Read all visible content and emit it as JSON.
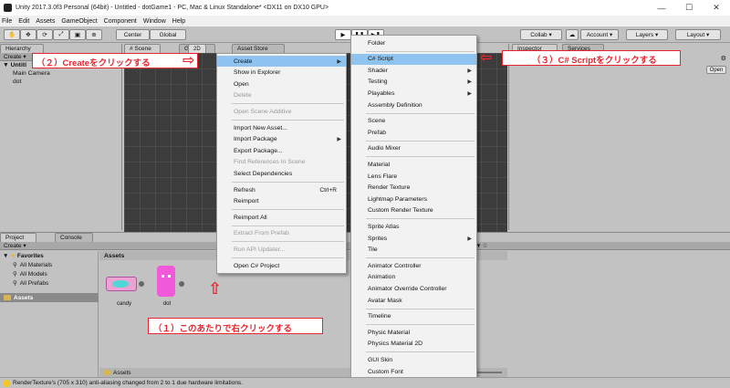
{
  "window": {
    "title": "Unity 2017.3.0f3 Personal (64bit) - Untitled - dotGame1 - PC, Mac & Linux Standalone* <DX11 on DX10 GPU>",
    "min": "—",
    "max": "☐",
    "close": "✕"
  },
  "menubar": [
    "File",
    "Edit",
    "Assets",
    "GameObject",
    "Component",
    "Window",
    "Help"
  ],
  "toolbar": {
    "center": "Center",
    "global": "Global",
    "collab": "Collab",
    "account": "Account",
    "layers": "Layers",
    "layout": "Layout",
    "play": "▶",
    "pause": "❚❚",
    "step": "▶❚"
  },
  "hierarchy": {
    "tab": "Hierarchy",
    "create": "Create",
    "scene": "Untitl",
    "items": [
      "Main Camera",
      "dot"
    ]
  },
  "scene_tabs": {
    "scene": "Scene",
    "game": "Game",
    "asset_store": "Asset Store",
    "mode": "2D"
  },
  "inspector": {
    "tab": "Inspector",
    "services": "Services",
    "open": "Open"
  },
  "project": {
    "tab": "Project",
    "console": "Console",
    "create": "Create",
    "favorites": "Favorites",
    "fav_items": [
      "All Materials",
      "All Models",
      "All Prefabs"
    ],
    "assets_root": "Assets",
    "assets_header": "Assets",
    "assets": [
      "candy",
      "dot"
    ],
    "footer": "Assets"
  },
  "context_menu": {
    "items": [
      {
        "label": "Create",
        "arrow": "▶",
        "state": "highlight"
      },
      {
        "label": "Show in Explorer"
      },
      {
        "label": "Open"
      },
      {
        "label": "Delete",
        "state": "disabled"
      },
      {
        "sep": true
      },
      {
        "label": "Open Scene Additive",
        "state": "disabled"
      },
      {
        "sep": true
      },
      {
        "label": "Import New Asset..."
      },
      {
        "label": "Import Package",
        "arrow": "▶"
      },
      {
        "label": "Export Package..."
      },
      {
        "label": "Find References In Scene",
        "state": "disabled"
      },
      {
        "label": "Select Dependencies"
      },
      {
        "sep": true
      },
      {
        "label": "Refresh",
        "shortcut": "Ctrl+R"
      },
      {
        "label": "Reimport"
      },
      {
        "sep": true
      },
      {
        "label": "Reimport All"
      },
      {
        "sep": true
      },
      {
        "label": "Extract From Prefab",
        "state": "disabled"
      },
      {
        "sep": true
      },
      {
        "label": "Run API Updater...",
        "state": "disabled"
      },
      {
        "sep": true
      },
      {
        "label": "Open C# Project"
      }
    ]
  },
  "submenu": {
    "items": [
      {
        "label": "Folder"
      },
      {
        "sep": true
      },
      {
        "label": "C# Script",
        "state": "highlight"
      },
      {
        "label": "Shader",
        "arrow": "▶"
      },
      {
        "label": "Testing",
        "arrow": "▶"
      },
      {
        "label": "Playables",
        "arrow": "▶"
      },
      {
        "label": "Assembly Definition"
      },
      {
        "sep": true
      },
      {
        "label": "Scene"
      },
      {
        "label": "Prefab"
      },
      {
        "sep": true
      },
      {
        "label": "Audio Mixer"
      },
      {
        "sep": true
      },
      {
        "label": "Material"
      },
      {
        "label": "Lens Flare"
      },
      {
        "label": "Render Texture"
      },
      {
        "label": "Lightmap Parameters"
      },
      {
        "label": "Custom Render Texture"
      },
      {
        "sep": true
      },
      {
        "label": "Sprite Atlas"
      },
      {
        "label": "Sprites",
        "arrow": "▶"
      },
      {
        "label": "Tile"
      },
      {
        "sep": true
      },
      {
        "label": "Animator Controller"
      },
      {
        "label": "Animation"
      },
      {
        "label": "Animator Override Controller"
      },
      {
        "label": "Avatar Mask"
      },
      {
        "sep": true
      },
      {
        "label": "Timeline"
      },
      {
        "sep": true
      },
      {
        "label": "Physic Material"
      },
      {
        "label": "Physics Material 2D"
      },
      {
        "sep": true
      },
      {
        "label": "GUI Skin"
      },
      {
        "label": "Custom Font"
      }
    ]
  },
  "annotations": {
    "step1": "（１）このあたりで右クリックする",
    "step2": "（２）Createをクリックする",
    "step3": "（３）C# Scriptをクリックする"
  },
  "status": {
    "message": "RenderTexture's (705 x 310) anti-aliasing changed from 2 to 1 due hardware limitations."
  },
  "colors": {
    "annotation": "#e8252f",
    "highlight": "#8fc4f1",
    "scene_bg": "#3c3c3c"
  }
}
